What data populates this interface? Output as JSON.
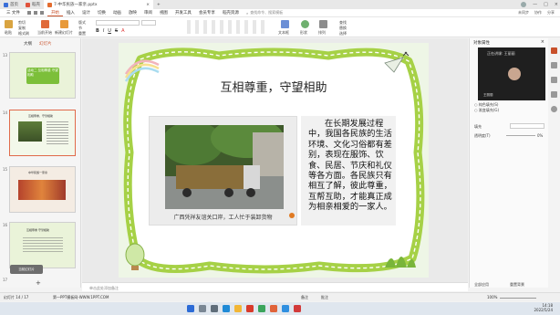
{
  "tabs": [
    {
      "label": "首页",
      "color": "#3b6fd8"
    },
    {
      "label": "稻壳",
      "color": "#e0533d"
    },
    {
      "label": "7-中华民族一家亲.pptx",
      "color": "#e36c2f"
    }
  ],
  "menu": {
    "file": "三 文件",
    "items": [
      "开始",
      "插入",
      "设计",
      "切换",
      "动画",
      "放映",
      "审阅",
      "视图",
      "开发工具",
      "会员专享",
      "稻壳资源"
    ],
    "active_index": 0,
    "search": "查找命令、搜索模板",
    "right": [
      "未同步",
      "协作",
      "分享"
    ]
  },
  "ribbon": {
    "paste": "粘贴",
    "format_painter": "格式刷",
    "cut": "剪切",
    "copy": "复制",
    "from_current": "当前开始",
    "new_slide": "新建幻灯片",
    "layout": "版式",
    "section": "节",
    "reset": "重置",
    "text_box": "文本框",
    "shape": "形状",
    "arrange": "排列",
    "find": "查找",
    "replace": "替换",
    "select": "选择"
  },
  "left_pane": {
    "tabs": [
      "大纲",
      "幻灯片"
    ],
    "slides": [
      {
        "num": "13",
        "title": "活动二 互相尊重 守望相助"
      },
      {
        "num": "14",
        "title": "互相尊重，守望相助"
      },
      {
        "num": "15",
        "title": "中华民族一家亲"
      },
      {
        "num": "16",
        "title": "互相尊重 守望相助"
      },
      {
        "num": "17",
        "title": ""
      }
    ],
    "selected": "14",
    "add_button": "+",
    "floating_button": "当前幻灯片"
  },
  "slide": {
    "title": "互相尊重，守望相助",
    "paragraph": "在长期发展过程中，我国各民族的生活环境、文化习俗都有差别，表现在服饰、饮食、民居、节庆和礼仪等各方面。各民族只有相互了解，彼此尊重，互帮互助，才能真正成为相亲相爱的一家人。",
    "caption": "广西凭祥友谊关口岸，工人忙于装卸货物"
  },
  "notes_placeholder": "单击此处添加备注",
  "right_pane": {
    "header": "对象属性",
    "video_title": "正在讲课: 王丽丽",
    "presenter": "王丽丽",
    "hide_bg": "隐藏背景图形",
    "fill_label": "填充",
    "fill_opts": [
      "纯色填充(S)",
      "渐变填充(G)",
      "图片或纹理填充(P)",
      "图案填充(A)"
    ],
    "transparency_label": "透明度(T)",
    "transparency_value": "0%",
    "apply_all": "全部应用",
    "reset_bg": "重置背景"
  },
  "status": {
    "slide_info": "幻灯片 14 / 17",
    "theme": "第一PPT模板网-WWW.1PPT.COM",
    "notes_btn": "备注",
    "comments_btn": "批注",
    "zoom": "100%"
  },
  "taskbar": {
    "time": "14:18",
    "date": "2022/5/24",
    "icons": [
      {
        "name": "windows",
        "color": "#2c6bd6"
      },
      {
        "name": "search",
        "color": "#7a8794"
      },
      {
        "name": "task-view",
        "color": "#5f6d7a"
      },
      {
        "name": "edge",
        "color": "#1f8ad6"
      },
      {
        "name": "explorer",
        "color": "#f2b636"
      },
      {
        "name": "wps",
        "color": "#d93a2b"
      },
      {
        "name": "chrome",
        "color": "#3ba55c"
      },
      {
        "name": "ppt",
        "color": "#e0633a"
      },
      {
        "name": "tencent",
        "color": "#2f8fe0"
      },
      {
        "name": "music",
        "color": "#d23a3a"
      }
    ]
  },
  "colors": {
    "accent": "#c8502a",
    "slide_green": "#9ccc3a",
    "slide_bg": "#eef6e6"
  }
}
